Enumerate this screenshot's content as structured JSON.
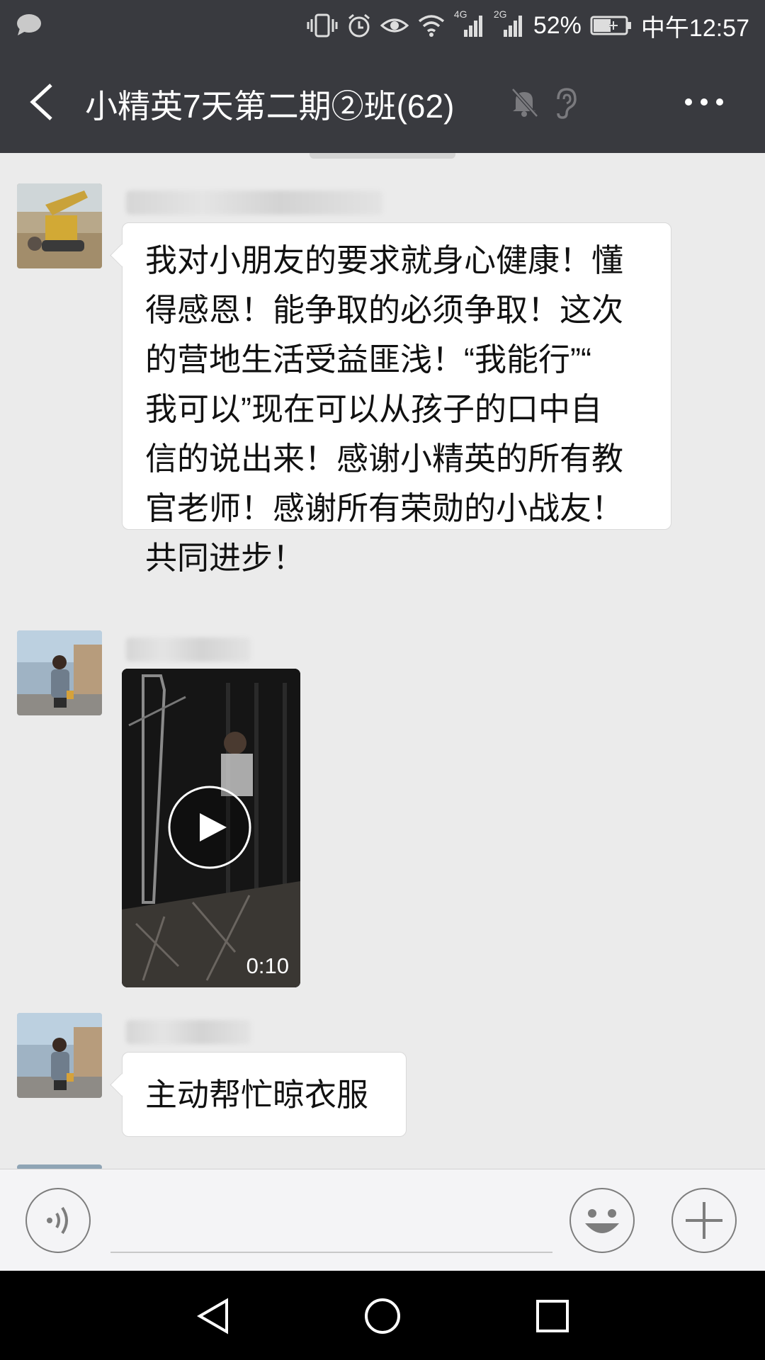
{
  "status_bar": {
    "battery": "52%",
    "time": "中午12:57",
    "net_1": "4G",
    "net_2": "2G"
  },
  "header": {
    "title": "小精英7天第二期②班(62)"
  },
  "messages": [
    {
      "type": "text",
      "lines": [
        "我对小朋友的要求就身心健康！懂",
        "得感恩！能争取的必须争取！这次",
        "的营地生活受益匪浅！“我能行”“",
        "我可以”现在可以从孩子的口中自",
        "信的说出来！感谢小精英的所有教",
        "官老师！感谢所有荣勋的小战友！",
        "共同进步！"
      ]
    },
    {
      "type": "video",
      "duration": "0:10"
    },
    {
      "type": "text",
      "lines": [
        "主动帮忙晾衣服"
      ]
    }
  ],
  "colors": {
    "header_bg": "#393a3f",
    "chat_bg": "#ebebeb",
    "bubble_bg": "#ffffff",
    "input_bg": "#f4f4f6"
  },
  "icons": [
    "chat-indicator-icon",
    "vibrate-icon",
    "alarm-icon",
    "eye-icon",
    "wifi-icon",
    "signal-icon",
    "battery-icon",
    "back-icon",
    "mute-icon",
    "earpiece-icon",
    "more-icon",
    "play-icon",
    "voice-icon",
    "emoji-icon",
    "plus-icon",
    "nav-back-icon",
    "nav-home-icon",
    "nav-recents-icon"
  ]
}
